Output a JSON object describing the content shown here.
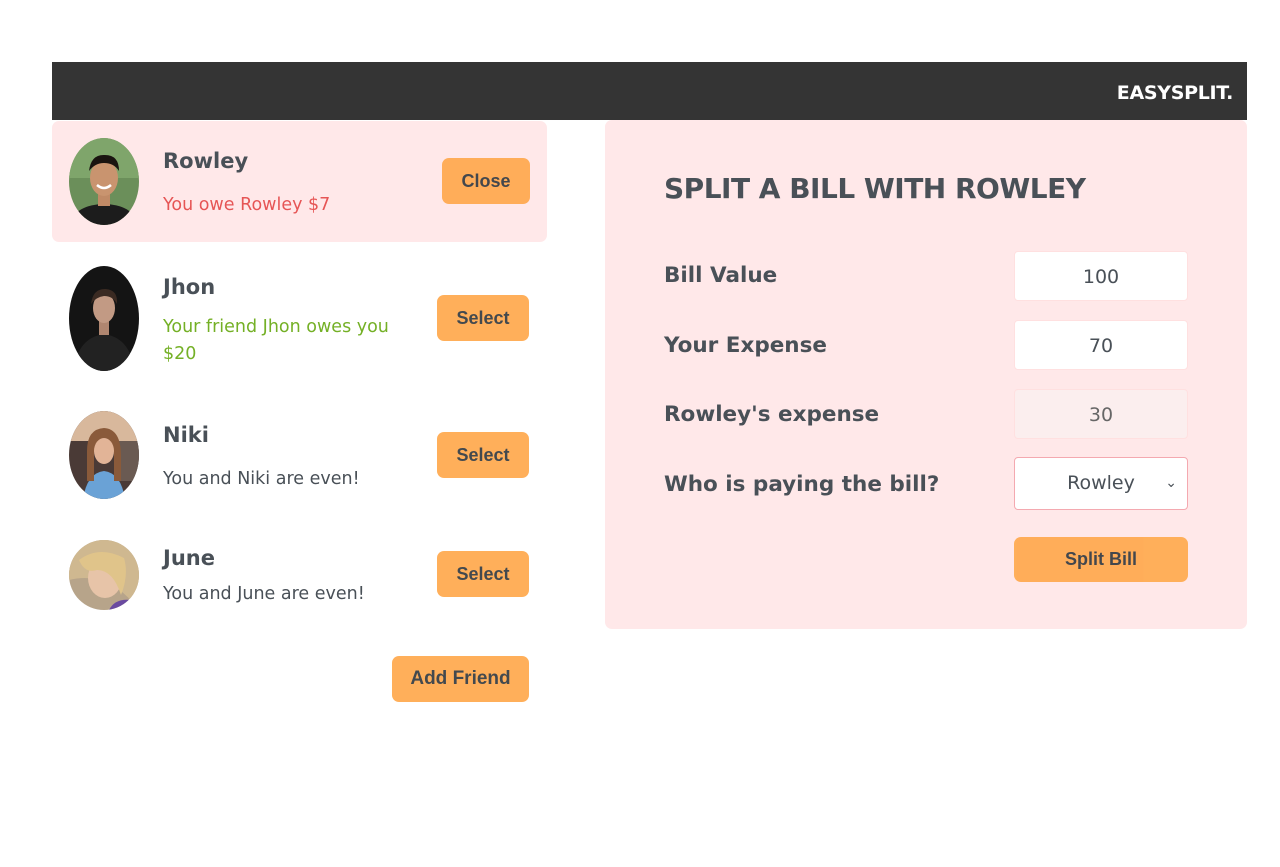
{
  "header": {
    "logo": "EASYSPLIT."
  },
  "friends": [
    {
      "name": "Rowley",
      "status": "You owe Rowley $7",
      "button": "Close",
      "selected": true
    },
    {
      "name": "Jhon",
      "status": "Your friend Jhon owes you $20",
      "button": "Select",
      "selected": false
    },
    {
      "name": "Niki",
      "status": "You and Niki are even!",
      "button": "Select",
      "selected": false
    },
    {
      "name": "June",
      "status": "You and June are even!",
      "button": "Select",
      "selected": false
    }
  ],
  "add_friend_label": "Add Friend",
  "split_form": {
    "title": "SPLIT A BILL WITH ROWLEY",
    "bill_value_label": "Bill Value",
    "bill_value": "100",
    "your_expense_label": "Your Expense",
    "your_expense": "70",
    "friend_expense_label": "Rowley's expense",
    "friend_expense": "30",
    "payer_label": "Who is paying the bill?",
    "payer_selected": "Rowley",
    "submit_label": "Split Bill"
  },
  "colors": {
    "accent": "#ffa94d",
    "panel": "#ffe8e9",
    "header": "#343434",
    "owe": "#e03131",
    "owed": "#66a80f"
  }
}
